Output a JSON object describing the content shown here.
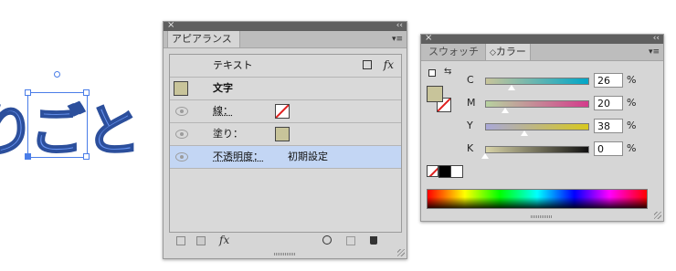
{
  "canvas": {
    "text_left": "り",
    "text_selected": "ご",
    "text_right": "と"
  },
  "appearance_panel": {
    "tab_label": "アピアランス",
    "header_label": "テキスト",
    "header_fx": "fx",
    "object_label": "文字",
    "rows": [
      {
        "label": "線：",
        "link": true,
        "swatch": "none"
      },
      {
        "label": "塗り：",
        "link": false,
        "swatch": "khaki"
      },
      {
        "label": "不透明度：",
        "link": true,
        "value": "初期設定",
        "selected": true
      }
    ],
    "footer_fx": "fx"
  },
  "color_panel": {
    "tab_swatches": "スウォッチ",
    "tab_color": "カラー",
    "tab_color_prefix": "◇",
    "sliders": [
      {
        "label": "C",
        "value": "26",
        "unit": "%",
        "fraction": 0.26,
        "gradient": [
          "#c8c49a",
          "#00a6c8"
        ]
      },
      {
        "label": "M",
        "value": "20",
        "unit": "%",
        "fraction": 0.2,
        "gradient": [
          "#b7d2a0",
          "#d43c8c"
        ]
      },
      {
        "label": "Y",
        "value": "38",
        "unit": "%",
        "fraction": 0.38,
        "gradient": [
          "#a9a8d8",
          "#d7c81e"
        ]
      },
      {
        "label": "K",
        "value": "0",
        "unit": "%",
        "fraction": 0.0,
        "gradient": [
          "#d8d3a8",
          "#111111"
        ]
      }
    ]
  },
  "colors": {
    "accent_blue": "#4a7de8",
    "glyph_blue": "#6a96f4",
    "fill_khaki": "#c8c49a",
    "selected_row": "#c3d6f4"
  },
  "icons": {
    "close": "×",
    "collapse": "‹‹",
    "menu": "▾≡"
  }
}
